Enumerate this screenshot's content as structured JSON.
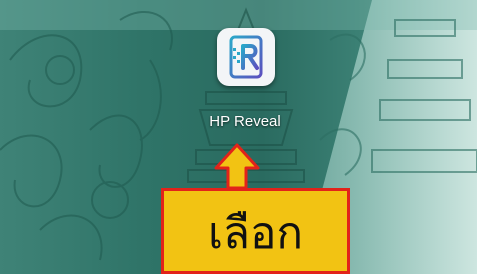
{
  "screen": {
    "wallpaper": "green-ornamental-pattern",
    "colors": {
      "wallpaper_dark": "#2a6b60",
      "wallpaper_light": "#6aa69a",
      "ornament_line": "#1f5a4f",
      "highlight_beam": "#b7dcd3"
    }
  },
  "app": {
    "label": "HP Reveal",
    "icon": "hp-reveal-logo-icon",
    "icon_colors": {
      "tile": "#f3f5f7",
      "gradient_start": "#2aa7c9",
      "gradient_end": "#5b4fbf"
    }
  },
  "callout": {
    "text": "เลือก",
    "pointer_icon": "arrow-up-icon",
    "colors": {
      "fill": "#f2c313",
      "border": "#e2231a"
    }
  }
}
